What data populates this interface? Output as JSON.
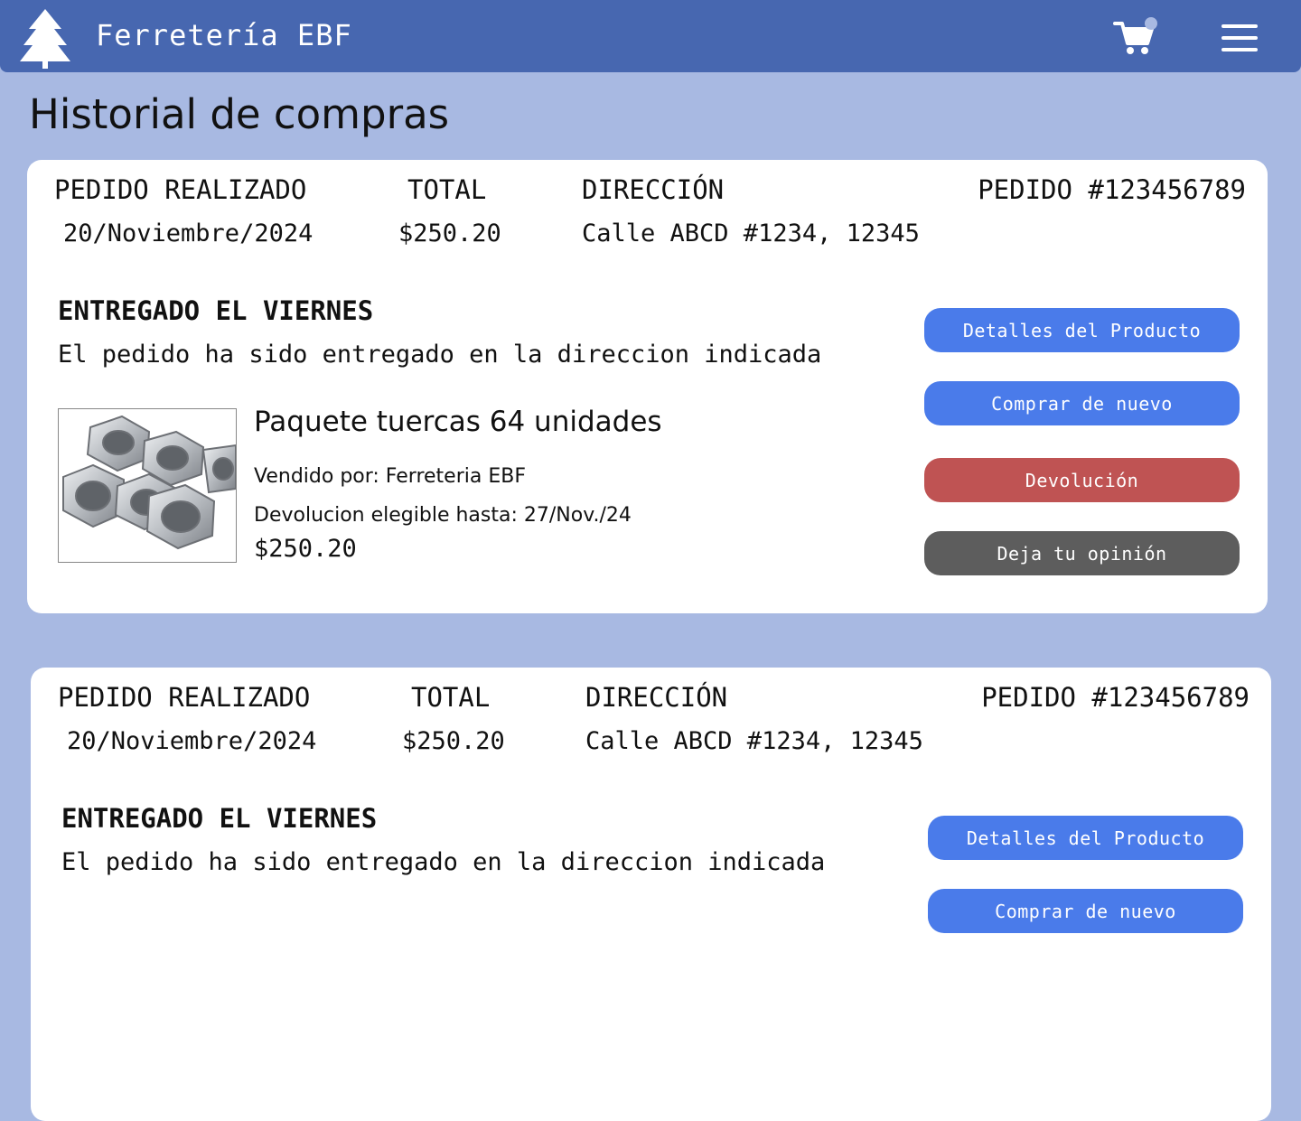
{
  "header": {
    "brand": "Ferretería EBF",
    "cart_icon": "cart-icon",
    "menu_icon": "hamburger-menu-icon",
    "logo_icon": "pine-tree-logo",
    "accent_color": "#4767b0",
    "background_color": "#a8b9e2"
  },
  "page": {
    "title": "Historial de compras"
  },
  "orders": [
    {
      "placed_label": "PEDIDO REALIZADO",
      "placed_date": "20/Noviembre/2024",
      "total_label": "TOTAL",
      "total": "$250.20",
      "address_label": "DIRECCIÓN",
      "address": "Calle ABCD #1234, 12345",
      "order_number": "PEDIDO #123456789",
      "status": "ENTREGADO EL VIERNES",
      "status_desc": "El pedido ha sido entregado en la direccion indicada",
      "product_name": "Paquete tuercas 64 unidades",
      "sold_by": "Vendido por: Ferreteria EBF",
      "return_until": "Devolucion elegible hasta: 27/Nov./24",
      "price": "$250.20",
      "buttons": {
        "details": "Detalles del Producto",
        "buy_again": "Comprar de nuevo",
        "return": "Devolución",
        "review": "Deja tu opinión"
      }
    },
    {
      "placed_label": "PEDIDO REALIZADO",
      "placed_date": "20/Noviembre/2024",
      "total_label": "TOTAL",
      "total": "$250.20",
      "address_label": "DIRECCIÓN",
      "address": "Calle ABCD #1234, 12345",
      "order_number": "PEDIDO #123456789",
      "status": "ENTREGADO EL VIERNES",
      "status_desc": "El pedido ha sido entregado en la direccion indicada",
      "buttons": {
        "details": "Detalles del Producto",
        "buy_again": "Comprar de nuevo"
      }
    }
  ],
  "button_colors": {
    "primary": "#4a7bea",
    "danger": "#bf5353",
    "neutral": "#5d5d5d"
  }
}
